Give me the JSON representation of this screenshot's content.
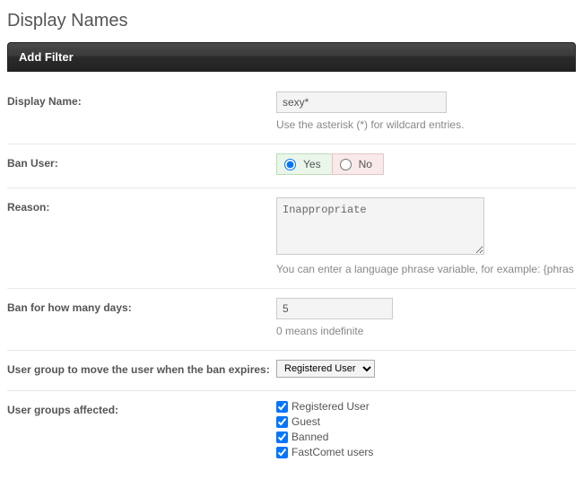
{
  "page_title": "Display Names",
  "panel_title": "Add Filter",
  "fields": {
    "display_name": {
      "label": "Display Name:",
      "value": "sexy*",
      "hint": "Use the asterisk (*) for wildcard entries."
    },
    "ban_user": {
      "label": "Ban User:",
      "yes": "Yes",
      "no": "No",
      "selected": "yes"
    },
    "reason": {
      "label": "Reason:",
      "value": "Inappropriate",
      "hint": "You can enter a language phrase variable, for example: {phras"
    },
    "ban_days": {
      "label": "Ban for how many days:",
      "value": "5",
      "hint": "0 means indefinite"
    },
    "move_group": {
      "label": "User group to move the user when the ban expires:",
      "selected": "Registered User"
    },
    "affected_groups": {
      "label": "User groups affected:",
      "items": [
        "Registered User",
        "Guest",
        "Banned",
        "FastComet users"
      ]
    }
  }
}
